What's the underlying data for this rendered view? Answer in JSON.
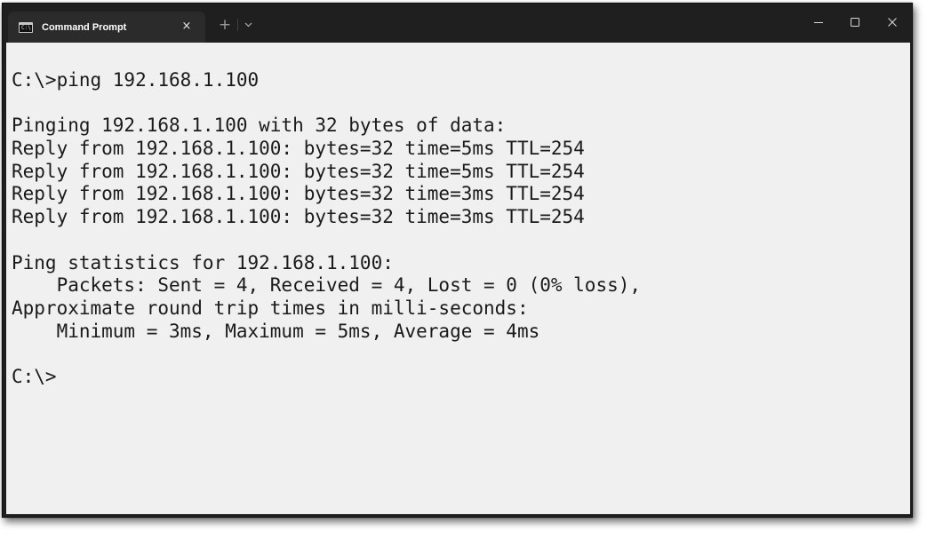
{
  "window": {
    "tab_title": "Command Prompt",
    "tab_icon_text": "C:\\",
    "tab_close": "×",
    "new_tab": "+",
    "colors": {
      "titlebar": "#1f1f1f",
      "tab_active": "#2b2b2b",
      "terminal_bg": "#f0f0f0",
      "terminal_text": "#1a1a1a"
    },
    "icons": [
      "cmd-icon",
      "close-tab-icon",
      "plus-icon",
      "chevron-down-icon",
      "minimize-icon",
      "maximize-icon",
      "close-window-icon"
    ]
  },
  "terminal": {
    "lines": [
      "C:\\>ping 192.168.1.100",
      "",
      "Pinging 192.168.1.100 with 32 bytes of data:",
      "Reply from 192.168.1.100: bytes=32 time=5ms TTL=254",
      "Reply from 192.168.1.100: bytes=32 time=5ms TTL=254",
      "Reply from 192.168.1.100: bytes=32 time=3ms TTL=254",
      "Reply from 192.168.1.100: bytes=32 time=3ms TTL=254",
      "",
      "Ping statistics for 192.168.1.100:",
      "    Packets: Sent = 4, Received = 4, Lost = 0 (0% loss),",
      "Approximate round trip times in milli-seconds:",
      "    Minimum = 3ms, Maximum = 5ms, Average = 4ms",
      "",
      "C:\\>"
    ]
  }
}
